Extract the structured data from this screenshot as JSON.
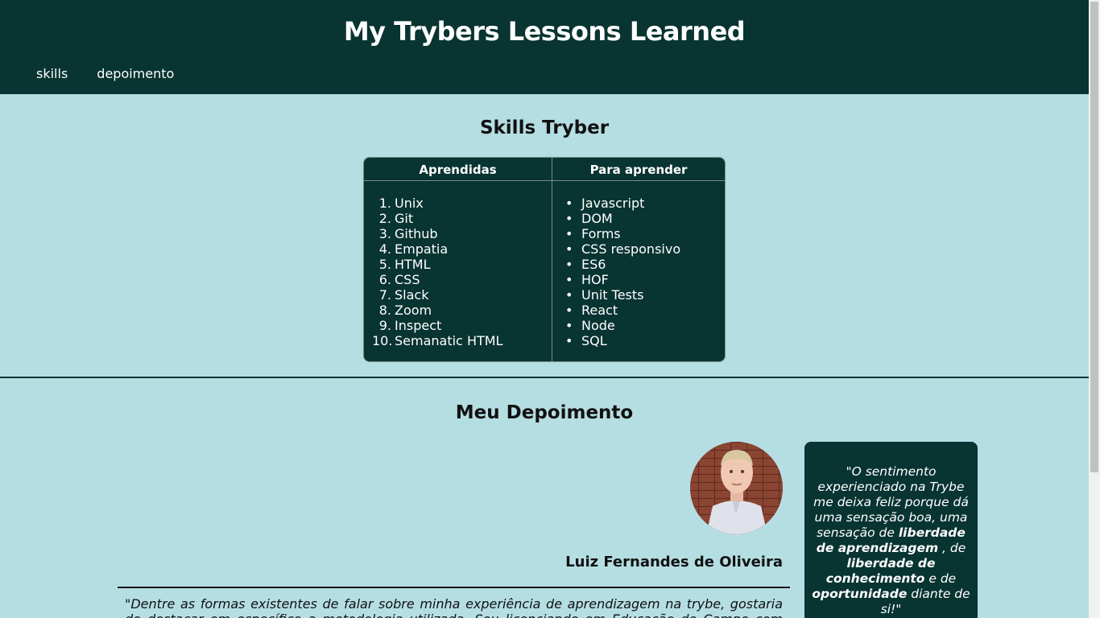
{
  "header": {
    "title": "My Trybers Lessons Learned",
    "nav": [
      "skills",
      "depoimento"
    ]
  },
  "skills": {
    "title": "Skills Tryber",
    "col_learned": "Aprendidas",
    "col_to_learn": "Para aprender",
    "learned": [
      "Unix",
      "Git",
      "Github",
      "Empatia",
      "HTML",
      "CSS",
      "Slack",
      "Zoom",
      "Inspect",
      "Semanatic HTML"
    ],
    "to_learn": [
      "Javascript",
      "DOM",
      "Forms",
      "CSS responsivo",
      "ES6",
      "HOF",
      "Unit Tests",
      "React",
      "Node",
      "SQL"
    ]
  },
  "testimonial": {
    "title": "Meu Depoimento",
    "author": "Luiz Fernandes de Oliveira",
    "text": "\"Dentre as formas existentes de falar sobre minha experiência de aprendizagem na trybe, gostaria de destacar em específico a metodologia utilizada. Sou licenciando em Educação do Campo com Habilitação em",
    "quote_parts": {
      "p1": "\"O sentimento experienciado na Trybe me deixa feliz porque dá uma sensação boa, uma sensação de ",
      "b1": "liberdade de aprendizagem",
      "p2": " , de ",
      "b2": "liberdade de conhecimento",
      "p3": " e de ",
      "b3": "oportunidade",
      "p4": " diante de si!\""
    }
  }
}
